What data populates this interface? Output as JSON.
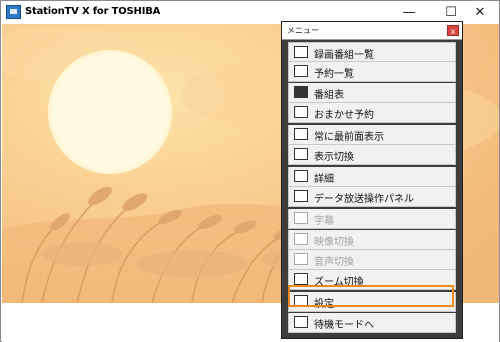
{
  "app": {
    "title": "StationTV X for TOSHIBA",
    "controls": {
      "minimize": "—",
      "maximize": "☐",
      "close": "✕"
    }
  },
  "menu": {
    "title": "メニュー",
    "close": "x",
    "items": [
      {
        "label": "録画番組一覧",
        "icon": "recorded-list-icon",
        "enabled": true
      },
      {
        "label": "予約一覧",
        "icon": "reservation-list-icon",
        "enabled": true
      },
      {
        "label": "番組表",
        "icon": "program-guide-icon",
        "enabled": true
      },
      {
        "label": "おまかせ予約",
        "icon": "auto-reservation-icon",
        "enabled": true
      },
      {
        "label": "常に最前面表示",
        "icon": "always-on-top-icon",
        "enabled": true
      },
      {
        "label": "表示切換",
        "icon": "display-switch-icon",
        "enabled": true
      },
      {
        "label": "詳細",
        "icon": "info-icon",
        "enabled": true
      },
      {
        "label": "データ放送操作パネル",
        "icon": "data-broadcast-panel-icon",
        "enabled": true
      },
      {
        "label": "字幕",
        "icon": "subtitle-icon",
        "enabled": false
      },
      {
        "label": "映像切換",
        "icon": "video-switch-icon",
        "enabled": false
      },
      {
        "label": "音声切換",
        "icon": "audio-switch-icon",
        "enabled": false
      },
      {
        "label": "ズーム切換",
        "icon": "zoom-switch-icon",
        "enabled": true
      },
      {
        "label": "設定",
        "icon": "settings-gear-icon",
        "enabled": true,
        "highlighted": true
      },
      {
        "label": "待機モードへ",
        "icon": "standby-icon",
        "enabled": true
      }
    ]
  },
  "colors": {
    "highlight_border": "#ee8a1f",
    "menu_background": "#3d3d3d",
    "item_background": "#f1f1f1",
    "disabled_text": "#a3a3a3"
  }
}
